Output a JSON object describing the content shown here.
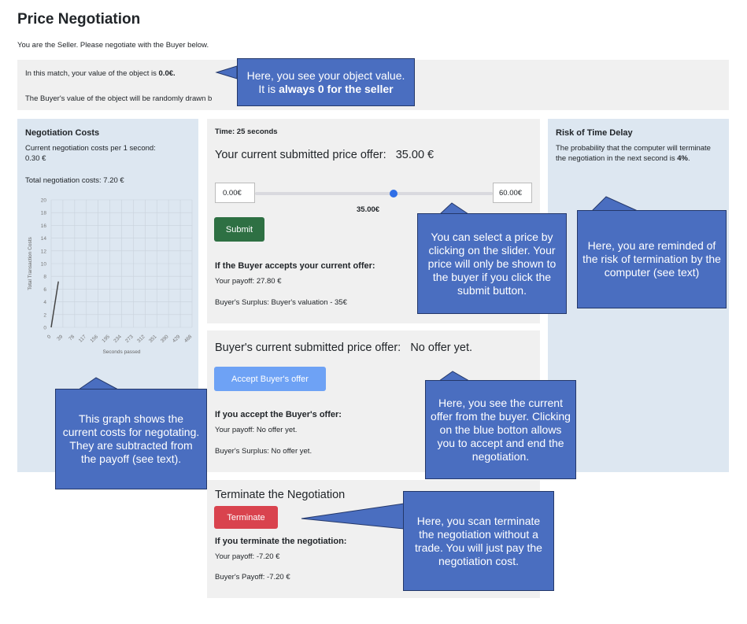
{
  "header": {
    "title": "Price Negotiation",
    "intro": "You are the Seller. Please negotiate with the Buyer below.",
    "value_prefix": "In this match, your value of the object is ",
    "value_amount": "0.0€.",
    "buyer_value_note": "The Buyer's value of the object will be randomly drawn b"
  },
  "costs_panel": {
    "title": "Negotiation Costs",
    "per_second": "Current negotiation costs per 1 second:",
    "per_second_value": "0.30 €",
    "total": "Total negotiation costs: 7.20 €"
  },
  "chart_data": {
    "type": "line",
    "xlabel": "Seconds passed",
    "ylabel": "Total Transaction Costs",
    "x_ticks": [
      "0",
      "39",
      "78",
      "117",
      "156",
      "195",
      "234",
      "273",
      "312",
      "351",
      "390",
      "429",
      "468"
    ],
    "y_ticks": [
      "0",
      "2",
      "4",
      "6",
      "8",
      "10",
      "12",
      "14",
      "16",
      "18",
      "20"
    ],
    "ylim": [
      0,
      20
    ],
    "x": [
      0,
      24
    ],
    "y": [
      0,
      7.2
    ],
    "grid": true
  },
  "offer_panel": {
    "time": "Time: 25 seconds",
    "heading_label": "Your current submitted price offer:",
    "heading_value": "35.00 €",
    "slider_min": "0.00€",
    "slider_max": "60.00€",
    "slider_value_label": "35.00€",
    "slider_fraction": 0.583,
    "submit_label": "Submit",
    "accept_heading": "If the Buyer accepts your current offer:",
    "payoff": "Your payoff: 27.80 €",
    "surplus": "Buyer's Surplus: Buyer's valuation - 35€"
  },
  "buyer_panel": {
    "heading_label": "Buyer's current submitted price offer:",
    "heading_value": "No offer yet.",
    "accept_button": "Accept Buyer's offer",
    "accept_heading": "If you accept the Buyer's offer:",
    "payoff": "Your payoff: No offer yet.",
    "surplus": "Buyer's Surplus: No offer yet."
  },
  "terminate_panel": {
    "heading": "Terminate the Negotiation",
    "button": "Terminate",
    "sub_heading": "If you terminate the negotiation:",
    "payoff": "Your payoff: -7.20 €",
    "buyer_payoff": "Buyer's Payoff: -7.20 €"
  },
  "risk_panel": {
    "title": "Risk of Time Delay",
    "text_prefix": "The probability that the computer will terminate the negotiation in the next second is ",
    "percent": "4%",
    "text_suffix": "."
  },
  "callouts": {
    "object_value_prefix": "Here, you see your object value. It is ",
    "object_value_bold": "always 0 for the seller",
    "slider": "You can select a price by clicking on the slider. Your price will only be shown to the buyer if you click the submit button.",
    "risk": "Here, you are reminded of the risk of termination by the computer (see text)",
    "graph": "This graph shows the current costs for negotating. They are subtracted from the payoff (see text).",
    "buyer_offer": "Here, you see the current offer from the buyer. Clicking on the blue botton allows you to accept and end the negotiation.",
    "terminate": "Here, you scan terminate the negotiation without a trade. You will just pay the negotiation cost."
  },
  "colors": {
    "accent_blue": "#4a6ec0",
    "slider_thumb": "#2f6ee6",
    "submit_green": "#2e7043",
    "terminate_red": "#d9434e"
  }
}
